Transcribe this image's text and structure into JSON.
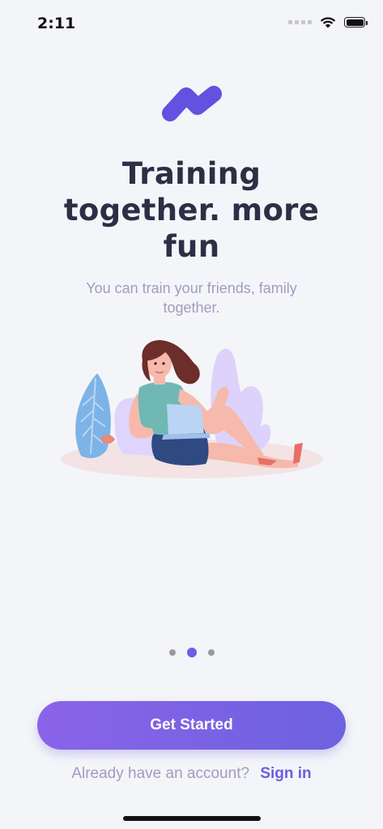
{
  "status": {
    "time": "2:11"
  },
  "onboarding": {
    "title_line1": "Training",
    "title_line2": "together. more",
    "title_line3": "fun",
    "subtitle": "You can train your friends, family together.",
    "pager": {
      "total": 3,
      "active_index": 1
    },
    "cta_label": "Get Started",
    "signin_prompt": "Already have an account?",
    "signin_link": "Sign in"
  },
  "colors": {
    "background": "#f4f5f9",
    "accent": "#6d5ce0",
    "title": "#2c2f45",
    "muted": "#a29cbd"
  },
  "icons": [
    "logo-icon",
    "wifi-icon",
    "battery-icon",
    "cellular-signal-icon"
  ]
}
